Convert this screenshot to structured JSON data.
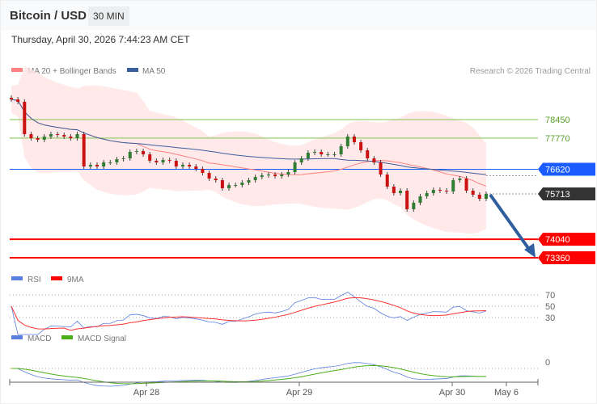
{
  "header": {
    "title": "Bitcoin / USD",
    "timeframe": "30 MIN",
    "datetime": "Thursday, April 30, 2026 7:44:23 AM CET"
  },
  "legend": {
    "ma20": "MA 20 + Bollinger Bands",
    "ma50": "MA 50",
    "credit": "Research © 2026 Trading Central",
    "rsi": "RSI",
    "rsi_ma": "9MA",
    "macd": "MACD",
    "macd_signal": "MACD Signal"
  },
  "colors": {
    "ma20": "#ff8080",
    "ma50": "#3a5f9e",
    "resistance": "#9acd6e",
    "pivot": "#1a5cff",
    "support": "#ff0000",
    "current": "#333333",
    "up": "#2f7d32",
    "down": "#cc1111"
  },
  "chart_data": {
    "type": "candlestick",
    "levels": [
      {
        "label": "78450",
        "value": 78450,
        "kind": "resistance"
      },
      {
        "label": "77770",
        "value": 77770,
        "kind": "resistance"
      },
      {
        "label": "76620",
        "value": 76620,
        "kind": "pivot"
      },
      {
        "label": "75713",
        "value": 75713,
        "kind": "current"
      },
      {
        "label": "74040",
        "value": 74040,
        "kind": "support"
      },
      {
        "label": "73360",
        "value": 73360,
        "kind": "support"
      }
    ],
    "closes": [
      79194,
      79105,
      77914,
      77765,
      77706,
      77825,
      77914,
      77884,
      77825,
      77765,
      77914,
      76723,
      76783,
      76723,
      76872,
      76872,
      76991,
      77021,
      77259,
      77289,
      77170,
      76932,
      76872,
      76962,
      76932,
      76723,
      76783,
      76723,
      76634,
      76485,
      76277,
      76217,
      75920,
      76039,
      76039,
      76128,
      76217,
      76336,
      76396,
      76426,
      76366,
      76426,
      76515,
      76872,
      77021,
      77229,
      77259,
      77170,
      77170,
      77170,
      77468,
      77825,
      77616,
      77319,
      77021,
      76872,
      76426,
      75979,
      75741,
      75830,
      75146,
      75384,
      75622,
      75741,
      75860,
      75830,
      75801,
      76217,
      76277,
      75830,
      75682,
      75533,
      75713
    ],
    "x_ticks": [
      "Apr 28",
      "Apr 29",
      "Apr 30",
      "May 6"
    ],
    "rsi_levels": [
      "70",
      "50",
      "30"
    ],
    "macd_zero": "0",
    "forecast": "bearish arrow toward 73360"
  }
}
